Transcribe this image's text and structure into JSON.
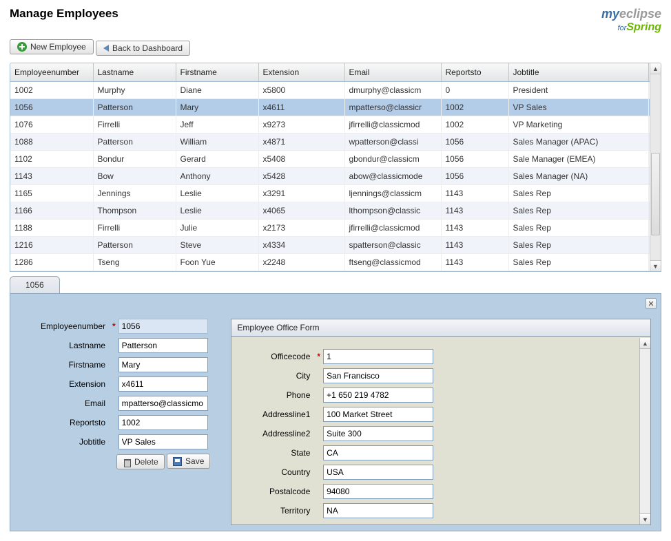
{
  "page_title": "Manage Employees",
  "logo": {
    "my": "my",
    "eclipse": "eclipse",
    "for": "for",
    "spring": "Spring"
  },
  "toolbar": {
    "new_employee": "New Employee",
    "back_to_dashboard": "Back to Dashboard"
  },
  "grid": {
    "columns": [
      "Employeenumber",
      "Lastname",
      "Firstname",
      "Extension",
      "Email",
      "Reportsto",
      "Jobtitle"
    ],
    "selected_index": 1,
    "rows": [
      {
        "num": "1002",
        "last": "Murphy",
        "first": "Diane",
        "ext": "x5800",
        "email": "dmurphy@classicm",
        "rep": "0",
        "job": "President"
      },
      {
        "num": "1056",
        "last": "Patterson",
        "first": "Mary",
        "ext": "x4611",
        "email": "mpatterso@classicr",
        "rep": "1002",
        "job": "VP Sales"
      },
      {
        "num": "1076",
        "last": "Firrelli",
        "first": "Jeff",
        "ext": "x9273",
        "email": "jfirrelli@classicmod",
        "rep": "1002",
        "job": "VP Marketing"
      },
      {
        "num": "1088",
        "last": "Patterson",
        "first": "William",
        "ext": "x4871",
        "email": "wpatterson@classi",
        "rep": "1056",
        "job": "Sales Manager (APAC)"
      },
      {
        "num": "1102",
        "last": "Bondur",
        "first": "Gerard",
        "ext": "x5408",
        "email": "gbondur@classicm",
        "rep": "1056",
        "job": "Sale Manager (EMEA)"
      },
      {
        "num": "1143",
        "last": "Bow",
        "first": "Anthony",
        "ext": "x5428",
        "email": "abow@classicmode",
        "rep": "1056",
        "job": "Sales Manager (NA)"
      },
      {
        "num": "1165",
        "last": "Jennings",
        "first": "Leslie",
        "ext": "x3291",
        "email": "ljennings@classicm",
        "rep": "1143",
        "job": "Sales Rep"
      },
      {
        "num": "1166",
        "last": "Thompson",
        "first": "Leslie",
        "ext": "x4065",
        "email": "lthompson@classic",
        "rep": "1143",
        "job": "Sales Rep"
      },
      {
        "num": "1188",
        "last": "Firrelli",
        "first": "Julie",
        "ext": "x2173",
        "email": "jfirrelli@classicmod",
        "rep": "1143",
        "job": "Sales Rep"
      },
      {
        "num": "1216",
        "last": "Patterson",
        "first": "Steve",
        "ext": "x4334",
        "email": "spatterson@classic",
        "rep": "1143",
        "job": "Sales Rep"
      },
      {
        "num": "1286",
        "last": "Tseng",
        "first": "Foon Yue",
        "ext": "x2248",
        "email": "ftseng@classicmod",
        "rep": "1143",
        "job": "Sales Rep"
      }
    ]
  },
  "tab_label": "1056",
  "detail_form": {
    "labels": {
      "employeenumber": "Employeenumber",
      "lastname": "Lastname",
      "firstname": "Firstname",
      "extension": "Extension",
      "email": "Email",
      "reportsto": "Reportsto",
      "jobtitle": "Jobtitle"
    },
    "values": {
      "employeenumber": "1056",
      "lastname": "Patterson",
      "firstname": "Mary",
      "extension": "x4611",
      "email": "mpatterso@classicmo",
      "reportsto": "1002",
      "jobtitle": "VP Sales"
    },
    "delete_label": "Delete",
    "save_label": "Save"
  },
  "office_form": {
    "title": "Employee Office Form",
    "labels": {
      "officecode": "Officecode",
      "city": "City",
      "phone": "Phone",
      "addressline1": "Addressline1",
      "addressline2": "Addressline2",
      "state": "State",
      "country": "Country",
      "postalcode": "Postalcode",
      "territory": "Territory"
    },
    "values": {
      "officecode": "1",
      "city": "San Francisco",
      "phone": "+1 650 219 4782",
      "addressline1": "100 Market Street",
      "addressline2": "Suite 300",
      "state": "CA",
      "country": "USA",
      "postalcode": "94080",
      "territory": "NA"
    }
  }
}
